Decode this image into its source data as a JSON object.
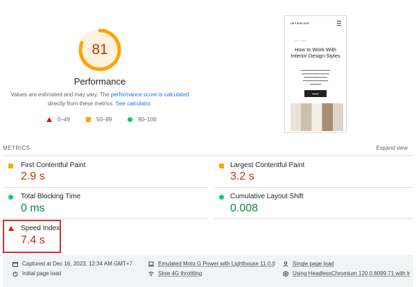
{
  "performance": {
    "score": "81",
    "title": "Performance",
    "desc_part1": "Values are estimated and may vary. The",
    "desc_link1": "performance score is calculated",
    "desc_part2": "directly from these metrics.",
    "desc_link2": "See calculator.",
    "legend": [
      {
        "shape": "triangle",
        "label": "0–49",
        "color": "#eb0f00"
      },
      {
        "shape": "square",
        "label": "50–89",
        "color": "#ffa400"
      },
      {
        "shape": "circle",
        "label": "90–100",
        "color": "#0cce6b"
      }
    ],
    "score_fraction": 0.81
  },
  "preview": {
    "brand": "INTERIOR",
    "title": "How to Work With Interior Design Styles"
  },
  "metrics": {
    "label": "METRICS",
    "expand": "Expand view",
    "items": [
      {
        "name": "First Contentful Paint",
        "value": "2.9 s",
        "status": "orange"
      },
      {
        "name": "Largest Contentful Paint",
        "value": "3.2 s",
        "status": "orange"
      },
      {
        "name": "Total Blocking Time",
        "value": "0 ms",
        "status": "green"
      },
      {
        "name": "Cumulative Layout Shift",
        "value": "0.008",
        "status": "green"
      },
      {
        "name": "Speed Index",
        "value": "7.4 s",
        "status": "red"
      }
    ]
  },
  "footer": {
    "captured": "Captured at Dec 16, 2023, 12:34 AM GMT+7",
    "initial": "Initial page load",
    "emulated": "Emulated Moto G Power with Lighthouse 11.0.0",
    "throttling": "Slow 4G throttling",
    "single": "Single page load",
    "using": "Using HeadlessChromium 120.0.6099.71 with lr"
  },
  "colors": {
    "gauge_fill": "#ffa400",
    "gauge_track": "#fff3e0",
    "orange_value": "#c33300",
    "green_value": "#0c8a3e",
    "red_value": "#c5221f"
  }
}
